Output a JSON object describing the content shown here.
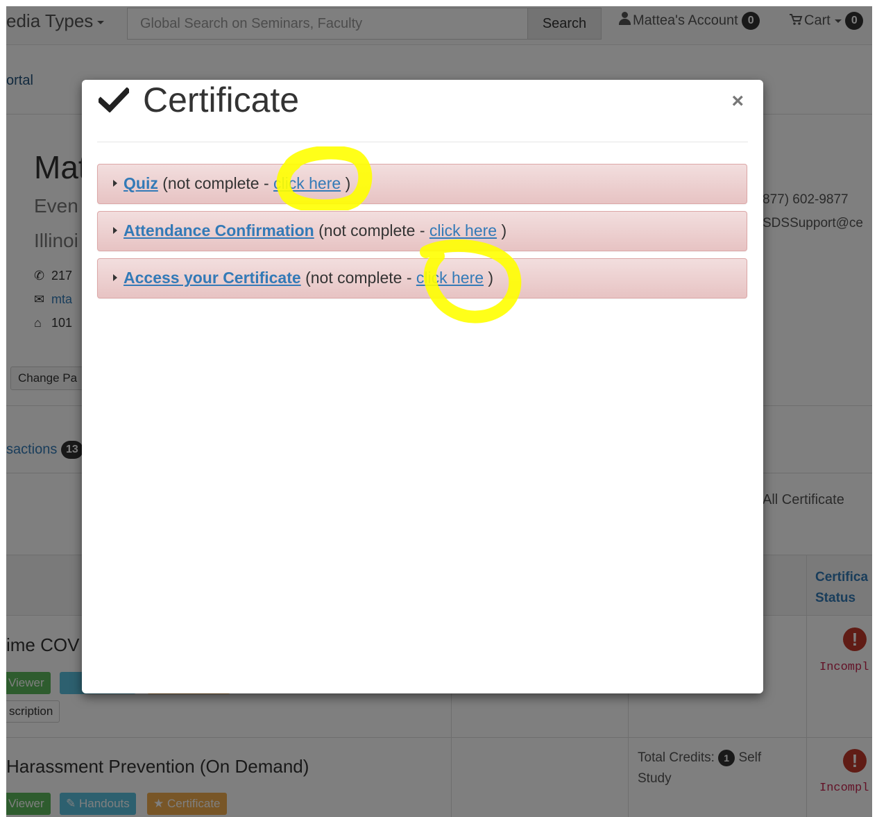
{
  "navbar": {
    "media_types": "edia Types",
    "search_placeholder": "Global Search on Seminars, Faculty",
    "search_button": "Search",
    "account_label": "Mattea's Account",
    "account_count": "0",
    "cart_label": "Cart",
    "cart_count": "0"
  },
  "breadcrumb": "ortal",
  "profile": {
    "name": "Mat",
    "line1": "Even",
    "line2": "Illinoi",
    "phone": "217",
    "email": "mta",
    "address": "101",
    "change_password": "Change Pa"
  },
  "support": {
    "phone": "877) 602-9877",
    "email": "SDSSupport@ce"
  },
  "tabs": {
    "transactions_label": "sactions",
    "transactions_count": "13"
  },
  "show_all_certificates": "ow All Certificate",
  "table": {
    "header_certificate": "Certifica",
    "header_status": "Status",
    "rows": [
      {
        "title": "ime COV",
        "viewer": "Viewer",
        "handouts_edge": "",
        "description": "scription",
        "status": "Incompl"
      },
      {
        "title": "Harassment Prevention (On Demand)",
        "viewer": "Viewer",
        "handouts": "Handouts",
        "certificate": "Certificate",
        "credits_label": "Total Credits:",
        "credits_count": "1",
        "credits_type": "Self Study",
        "status": "Incompl"
      }
    ]
  },
  "modal": {
    "title": "Certificate",
    "close": "×",
    "items": [
      {
        "name": "Quiz",
        "status_prefix": "(not complete - ",
        "link": "click here",
        "suffix": ")"
      },
      {
        "name": "Attendance Confirmation",
        "status_prefix": "(not complete - ",
        "link": "click here",
        "suffix": ")"
      },
      {
        "name": "Access your Certificate",
        "status_prefix": "(not complete - ",
        "link": "click here",
        "suffix": ")"
      }
    ]
  },
  "colors": {
    "highlight": "#ffff00",
    "link": "#337ab7",
    "panel_danger": "#f2dede"
  }
}
